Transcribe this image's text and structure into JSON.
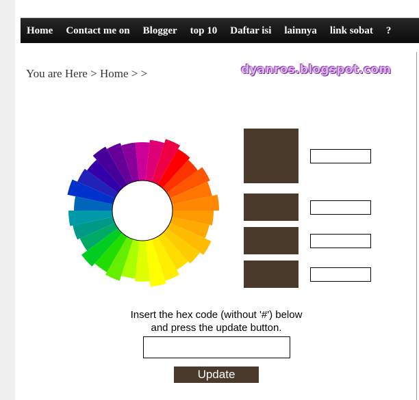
{
  "nav": {
    "items": [
      "Home",
      "Contact me on",
      "Blogger",
      "top 10",
      "Daftar isi",
      "lainnya",
      "link sobat",
      "?"
    ]
  },
  "breadcrumb": {
    "text": "You are Here > Home > >"
  },
  "blog": {
    "logo_text": "dyanros.blogspot.com"
  },
  "color_picker": {
    "wheel_colors": [
      "#cc0099",
      "#dd0077",
      "#ee0044",
      "#ff0000",
      "#ff3300",
      "#ff5500",
      "#ff7700",
      "#ff8800",
      "#ff9900",
      "#ffaa00",
      "#ffbb00",
      "#ffcc00",
      "#ffdd00",
      "#ffee00",
      "#ffff00",
      "#ddff00",
      "#aaff00",
      "#66ee00",
      "#22dd00",
      "#00cc22",
      "#00aa66",
      "#009988",
      "#0099aa",
      "#0066bb",
      "#0033cc",
      "#2222bb",
      "#3300aa",
      "#440099",
      "#660099",
      "#880099"
    ],
    "selected_color": "#4a3a2c",
    "hex_fields": [
      {
        "name": "main-hex",
        "value": ""
      },
      {
        "name": "shade-1-hex",
        "value": ""
      },
      {
        "name": "shade-2-hex",
        "value": ""
      },
      {
        "name": "shade-3-hex",
        "value": ""
      }
    ],
    "instructions_line1": "Insert the hex code (without '#') below",
    "instructions_line2": "and press the update button.",
    "input_value": "",
    "update_label": "Update"
  }
}
